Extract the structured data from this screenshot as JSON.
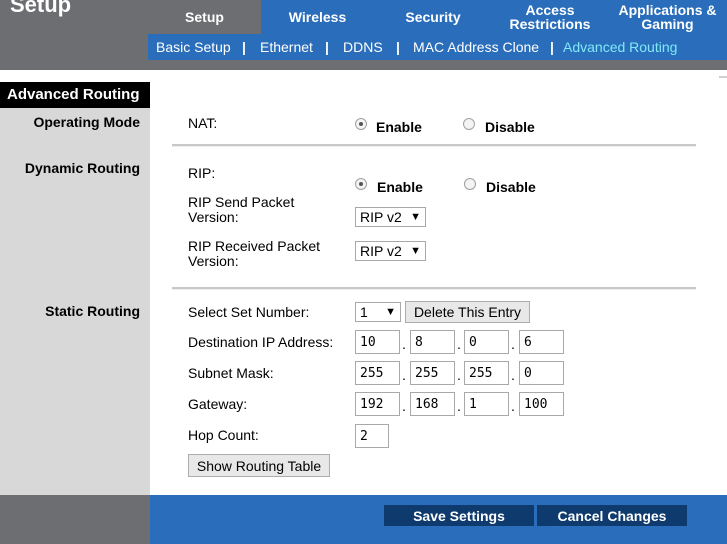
{
  "header": {
    "title": "Setup",
    "tabs": [
      {
        "label": "Setup",
        "active": true
      },
      {
        "label": "Wireless",
        "active": false
      },
      {
        "label": "Security",
        "active": false
      },
      {
        "label": "Access\nRestrictions",
        "active": false
      },
      {
        "label": "Applications &\nGaming",
        "active": false
      }
    ],
    "subtabs": [
      {
        "label": "Basic Setup"
      },
      {
        "label": "Ethernet"
      },
      {
        "label": "DDNS"
      },
      {
        "label": "MAC Address Clone"
      },
      {
        "label": "Advanced Routing",
        "active": true
      }
    ],
    "separator": "|"
  },
  "section_title": "Advanced Routing",
  "left_labels": {
    "operating_mode": "Operating Mode",
    "dynamic_routing": "Dynamic Routing",
    "static_routing": "Static Routing"
  },
  "operating_mode": {
    "nat_label": "NAT:",
    "enable_label": "Enable",
    "disable_label": "Disable",
    "selected": "Enable"
  },
  "dynamic_routing": {
    "rip_label": "RIP:",
    "enable_label": "Enable",
    "disable_label": "Disable",
    "selected": "Enable",
    "send_version_label_1": "RIP Send Packet",
    "send_version_label_2": "Version:",
    "send_version_value": "RIP v2",
    "recv_version_label_1": "RIP Received Packet",
    "recv_version_label_2": "Version:",
    "recv_version_value": "RIP v2"
  },
  "static_routing": {
    "select_set_label": "Select Set Number:",
    "select_set_value": "1",
    "delete_button": "Delete This Entry",
    "dest_ip_label": "Destination IP Address:",
    "dest_ip": [
      "10",
      "8",
      "0",
      "6"
    ],
    "subnet_label": "Subnet Mask:",
    "subnet": [
      "255",
      "255",
      "255",
      "0"
    ],
    "gateway_label": "Gateway:",
    "gateway": [
      "192",
      "168",
      "1",
      "100"
    ],
    "hop_label": "Hop Count:",
    "hop_value": "2",
    "show_table_button": "Show Routing Table",
    "ip_separator": "."
  },
  "footer": {
    "save_label": "Save Settings",
    "cancel_label": "Cancel Changes"
  },
  "icons": {
    "dropdown": "chevron-down-icon"
  },
  "colors": {
    "brand_blue": "#2a6ebb",
    "active_subtab": "#7fe9f7",
    "footer_button": "#0f3a6e"
  }
}
